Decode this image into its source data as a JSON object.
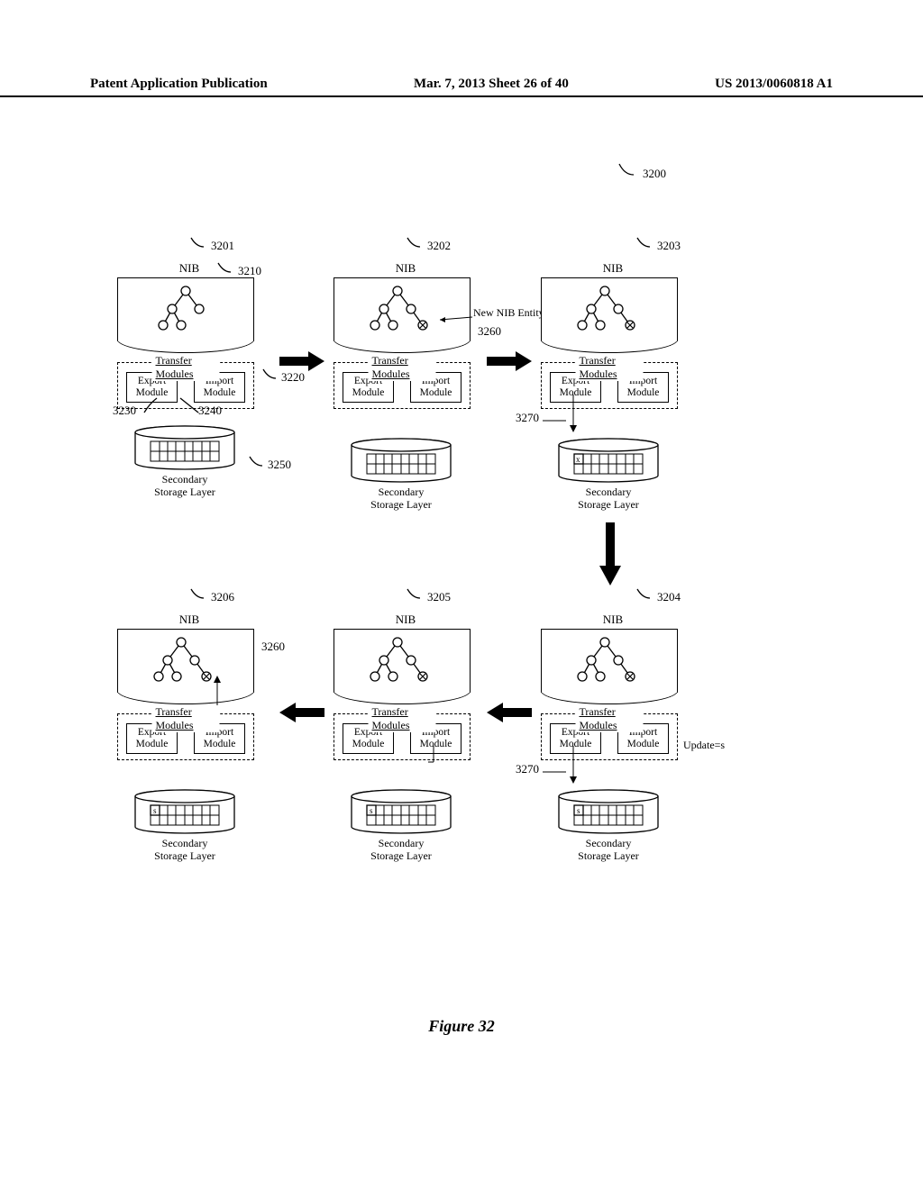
{
  "header": {
    "left": "Patent Application Publication",
    "center": "Mar. 7, 2013  Sheet 26 of 40",
    "right": "US 2013/0060818 A1"
  },
  "refs": {
    "r3200": "3200",
    "r3201": "3201",
    "r3202": "3202",
    "r3203": "3203",
    "r3204": "3204",
    "r3205": "3205",
    "r3206": "3206",
    "r3210": "3210",
    "r3220": "3220",
    "r3230": "3230",
    "r3240": "3240",
    "r3250": "3250",
    "r3260a": "3260",
    "r3260b": "3260",
    "r3270a": "3270",
    "r3270b": "3270"
  },
  "labels": {
    "nib": "NIB",
    "transfer": "Transfer Modules",
    "export": "Export\nModule",
    "import": "Import\nModule",
    "storage1": "Secondary",
    "storage2": "Storage Layer",
    "new_entity": "New NIB Entity",
    "update_s": "Update=s"
  },
  "symbols": {
    "x": "x",
    "s": "s"
  },
  "caption": "Figure 32"
}
